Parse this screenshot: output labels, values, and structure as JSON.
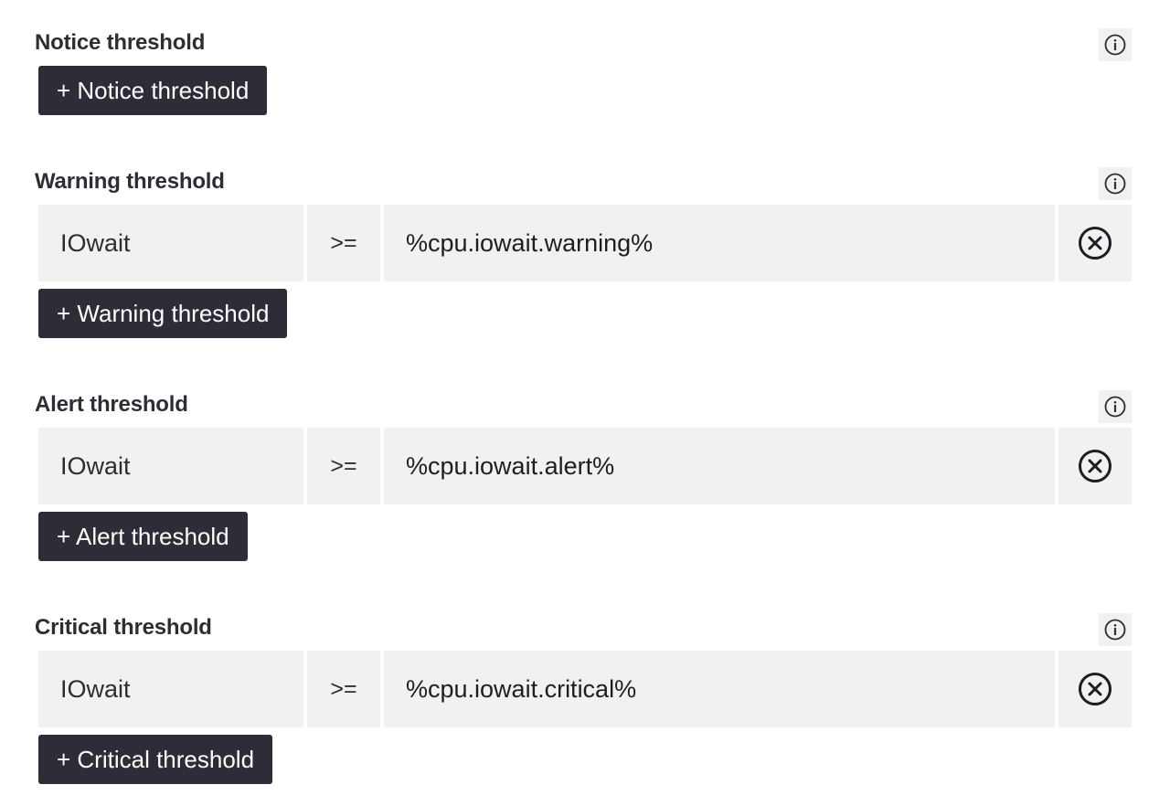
{
  "sections": {
    "notice": {
      "title": "Notice threshold",
      "add_label": "+ Notice threshold",
      "info_icon": "info-icon"
    },
    "warning": {
      "title": "Warning threshold",
      "add_label": "+ Warning threshold",
      "info_icon": "info-icon",
      "rule": {
        "metric": "IOwait",
        "operator": ">=",
        "value": "%cpu.iowait.warning%",
        "remove_icon": "close-circle-icon"
      }
    },
    "alert": {
      "title": "Alert threshold",
      "add_label": "+ Alert threshold",
      "info_icon": "info-icon",
      "rule": {
        "metric": "IOwait",
        "operator": ">=",
        "value": "%cpu.iowait.alert%",
        "remove_icon": "close-circle-icon"
      }
    },
    "critical": {
      "title": "Critical threshold",
      "add_label": "+ Critical threshold",
      "info_icon": "info-icon",
      "rule": {
        "metric": "IOwait",
        "operator": ">=",
        "value": "%cpu.iowait.critical%",
        "remove_icon": "close-circle-icon"
      }
    }
  },
  "colors": {
    "button_bg": "#2d2d38",
    "cell_bg": "#f1f1f1",
    "text": "#2d2d35"
  }
}
